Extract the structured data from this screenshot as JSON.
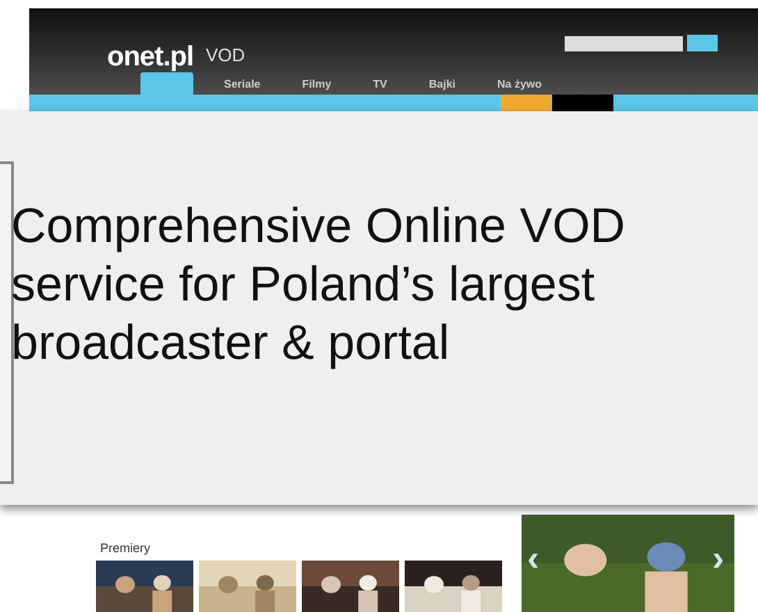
{
  "header": {
    "logo": "onet.pl",
    "logo_suffix": "VOD"
  },
  "nav": {
    "tabs": [
      {
        "label": "Seriale",
        "selected": false
      },
      {
        "label": "Filmy",
        "selected": false
      },
      {
        "label": "TV",
        "selected": false
      },
      {
        "label": "Bajki",
        "selected": false
      },
      {
        "label": "Na żywo",
        "selected": false
      }
    ]
  },
  "overlay": {
    "headline": "Comprehensive Online VOD service for Poland’s largest broadcaster & portal"
  },
  "premieres": {
    "title": "Premiery"
  },
  "featured": {
    "kind": "picture",
    "prev": "‹",
    "next": "›"
  }
}
